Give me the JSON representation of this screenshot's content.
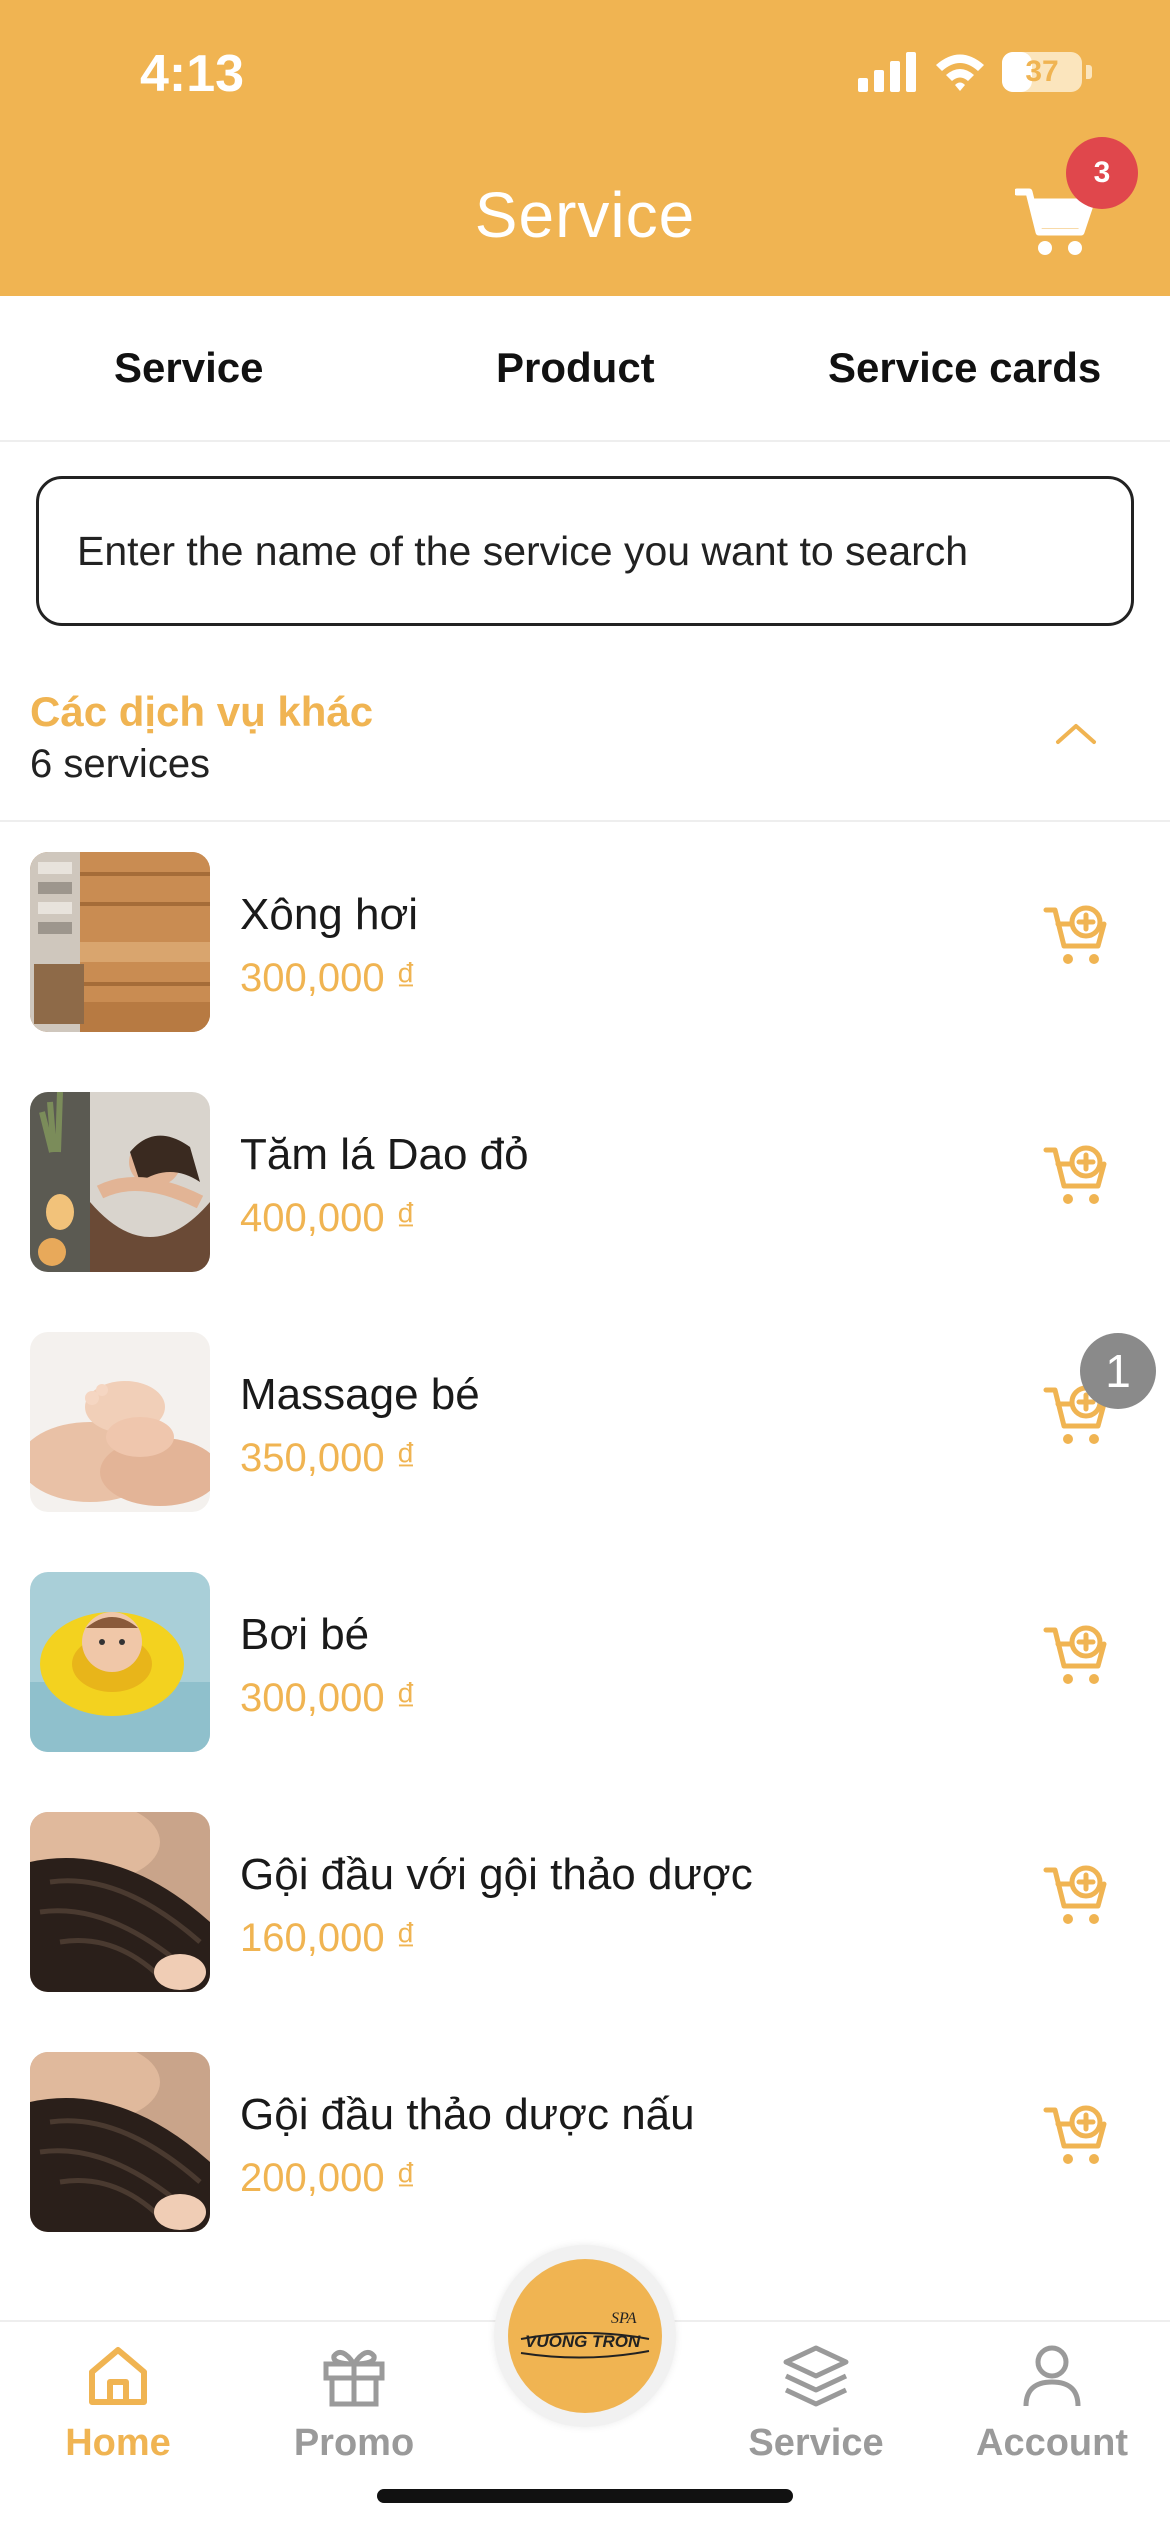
{
  "status_bar": {
    "time": "4:13",
    "battery": "37"
  },
  "header": {
    "title": "Service",
    "cart_count": "3"
  },
  "tabs": [
    {
      "label": "Service"
    },
    {
      "label": "Product"
    },
    {
      "label": "Service cards"
    }
  ],
  "search": {
    "placeholder": "Enter the name of the service you want to search"
  },
  "group": {
    "title": "Các dịch vụ khác",
    "count": "6 services",
    "items": [
      {
        "name": "Xông hơi",
        "price": "300,000 ₫",
        "image": "sauna-room"
      },
      {
        "name": "Tăm lá Dao đỏ",
        "price": "400,000 ₫",
        "image": "woman-bath"
      },
      {
        "name": "Massage bé",
        "price": "350,000 ₫",
        "image": "baby-feet"
      },
      {
        "name": "Bơi bé",
        "price": "300,000 ₫",
        "image": "baby-swim-float"
      },
      {
        "name": "Gội đầu với gội thảo dược",
        "price": "160,000 ₫",
        "image": "hair-wash"
      },
      {
        "name": "Gội đầu thảo dược nấu",
        "price": "200,000 ₫",
        "image": "hair-wash"
      }
    ]
  },
  "floating_badge": "1",
  "bottom_nav": {
    "items": [
      {
        "label": "Home",
        "icon": "home-icon"
      },
      {
        "label": "Promo",
        "icon": "gift-icon"
      },
      {
        "label": "Service",
        "icon": "layers-icon"
      },
      {
        "label": "Account",
        "icon": "user-icon"
      }
    ],
    "center_logo_line1": "SPA",
    "center_logo_line2": "VUONG TRON"
  },
  "colors": {
    "accent": "#F0B452",
    "badge_red": "#e0474c",
    "text": "#1a1a1a",
    "inactive": "#9a9a9a"
  }
}
